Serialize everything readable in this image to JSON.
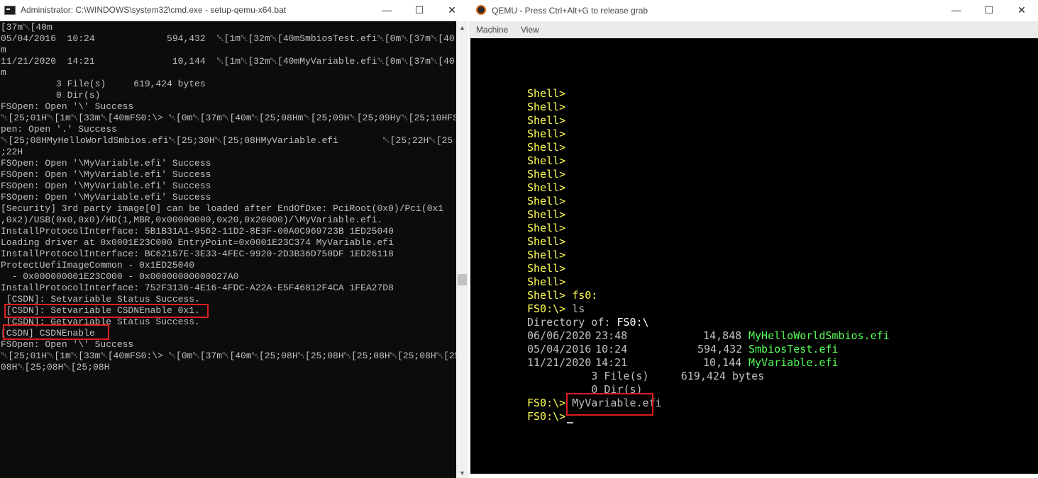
{
  "cmd": {
    "title": "Administrator: C:\\WINDOWS\\system32\\cmd.exe - setup-qemu-x64.bat",
    "min_glyph": "—",
    "max_glyph": "☐",
    "close_glyph": "✕",
    "lines": [
      "[37m␀[40m",
      "05/04/2016  10:24             594,432  ␀[1m␀[32m␀[40mSmbiosTest.efi␀[0m␀[37m␀[40",
      "m",
      "11/21/2020  14:21              10,144  ␀[1m␀[32m␀[40mMyVariable.efi␀[0m␀[37m␀[40",
      "m",
      "          3 File(s)     619,424 bytes",
      "          0 Dir(s)",
      "FSOpen: Open '\\' Success",
      "␀[25;01H␀[1m␀[33m␀[40mFS0:\\> ␀[0m␀[37m␀[40m␀[25;08Hm␀[25;09H␀[25;09Hy␀[25;10HFSO",
      "pen: Open '.' Success",
      "␀[25;08HMyHelloWorldSmbios.efi␀[25;30H␀[25;08HMyVariable.efi        ␀[25;22H␀[25",
      ";22H",
      "FSOpen: Open '\\MyVariable.efi' Success",
      "FSOpen: Open '\\MyVariable.efi' Success",
      "FSOpen: Open '\\MyVariable.efi' Success",
      "FSOpen: Open '\\MyVariable.efi' Success",
      "[Security] 3rd party image[0] can be loaded after EndOfDxe: PciRoot(0x0)/Pci(0x1",
      ",0x2)/USB(0x0,0x0)/HD(1,MBR,0x00000000,0x20,0x20000)/\\MyVariable.efi.",
      "InstallProtocolInterface: 5B1B31A1-9562-11D2-8E3F-00A0C969723B 1ED25040",
      "Loading driver at 0x0001E23C000 EntryPoint=0x0001E23C374 MyVariable.efi",
      "InstallProtocolInterface: BC62157E-3E33-4FEC-9920-2D3B36D750DF 1ED26118",
      "ProtectUefiImageCommon - 0x1ED25040",
      "  - 0x000000001E23C000 - 0x00000000000027A0",
      "InstallProtocolInterface: 752F3136-4E16-4FDC-A22A-E5F46812F4CA 1FEA27D8",
      " [CSDN]: Setvariable Status Success.",
      " [CSDN]: Setvariable CSDNEnable 0x1.",
      " [CSDN]: Getvariable Status Success.",
      "[CSDN] CSDNEnable",
      "FSOpen: Open '\\' Success",
      "␀[25;01H␀[1m␀[33m␀[40mFS0:\\> ␀[0m␀[37m␀[40m␀[25;08H␀[25;08H␀[25;08H␀[25;08H␀[25;",
      "08H␀[25;08H␀[25;08H"
    ],
    "scroll_up_glyph": "▲",
    "scroll_down_glyph": "▼"
  },
  "qemu": {
    "title": "QEMU - Press Ctrl+Alt+G to release grab",
    "min_glyph": "—",
    "max_glyph": "☐",
    "close_glyph": "✕",
    "menu": [
      "Machine",
      "View"
    ],
    "shell_prompt": "Shell>",
    "shell_cmd": "Shell> fs0:",
    "fs_prompt": "FS0:\\>",
    "ls_cmd": " ls",
    "dir_label": "Directory of: ",
    "dir_path": "FS0:\\",
    "files": [
      {
        "date": "06/06/2020",
        "time": "23:48",
        "size": "14,848",
        "name": "MyHelloWorldSmbios.efi"
      },
      {
        "date": "05/04/2016",
        "time": "10:24",
        "size": "594,432",
        "name": "SmbiosTest.efi"
      },
      {
        "date": "11/21/2020",
        "time": "14:21",
        "size": "10,144",
        "name": "MyVariable.efi"
      }
    ],
    "file_count_line": "          3 File(s)     619,424 bytes",
    "dir_count_line": "          0 Dir(s)",
    "run_cmd": " MyVariable.efi",
    "highlight_color": "#e01d1d"
  }
}
